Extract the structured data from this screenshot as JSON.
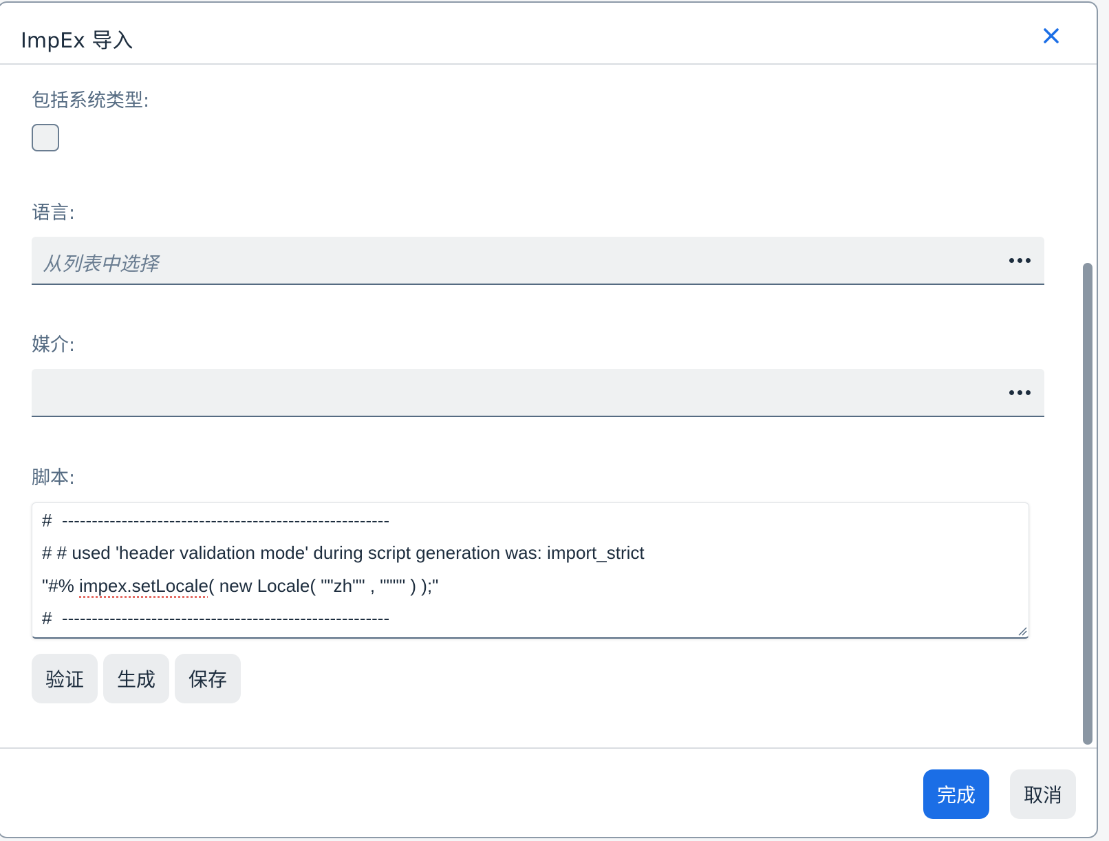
{
  "dialog": {
    "title": "ImpEx 导入",
    "close_icon": "close-icon"
  },
  "fields": {
    "include_system_types": {
      "label": "包括系统类型:",
      "checked": false
    },
    "language": {
      "label": "语言:",
      "placeholder": "从列表中选择",
      "value_help_icon": "more-icon"
    },
    "media": {
      "label": "媒介:",
      "value": "",
      "value_help_icon": "more-icon"
    },
    "script": {
      "label": "脚本:",
      "lines": [
        "#  -------------------------------------------------------",
        "# # used 'header validation mode' during script generation was: import_strict",
        "\"#% impex.setLocale( new Locale( \"\"zh\"\" , \"\"\"\" ) );\"",
        "#  -------------------------------------------------------"
      ],
      "line3_prefix": "\"#% ",
      "line3_misspelled": "impex.setLocale",
      "line3_suffix": "( new Locale( \"\"zh\"\" , \"\"\"\" ) );\""
    }
  },
  "script_actions": {
    "validate": "验证",
    "generate": "生成",
    "save": "保存"
  },
  "footer": {
    "done": "完成",
    "cancel": "取消"
  },
  "colors": {
    "accent": "#1b6ee6",
    "label": "#556b82",
    "field_bg": "#eff1f2"
  }
}
